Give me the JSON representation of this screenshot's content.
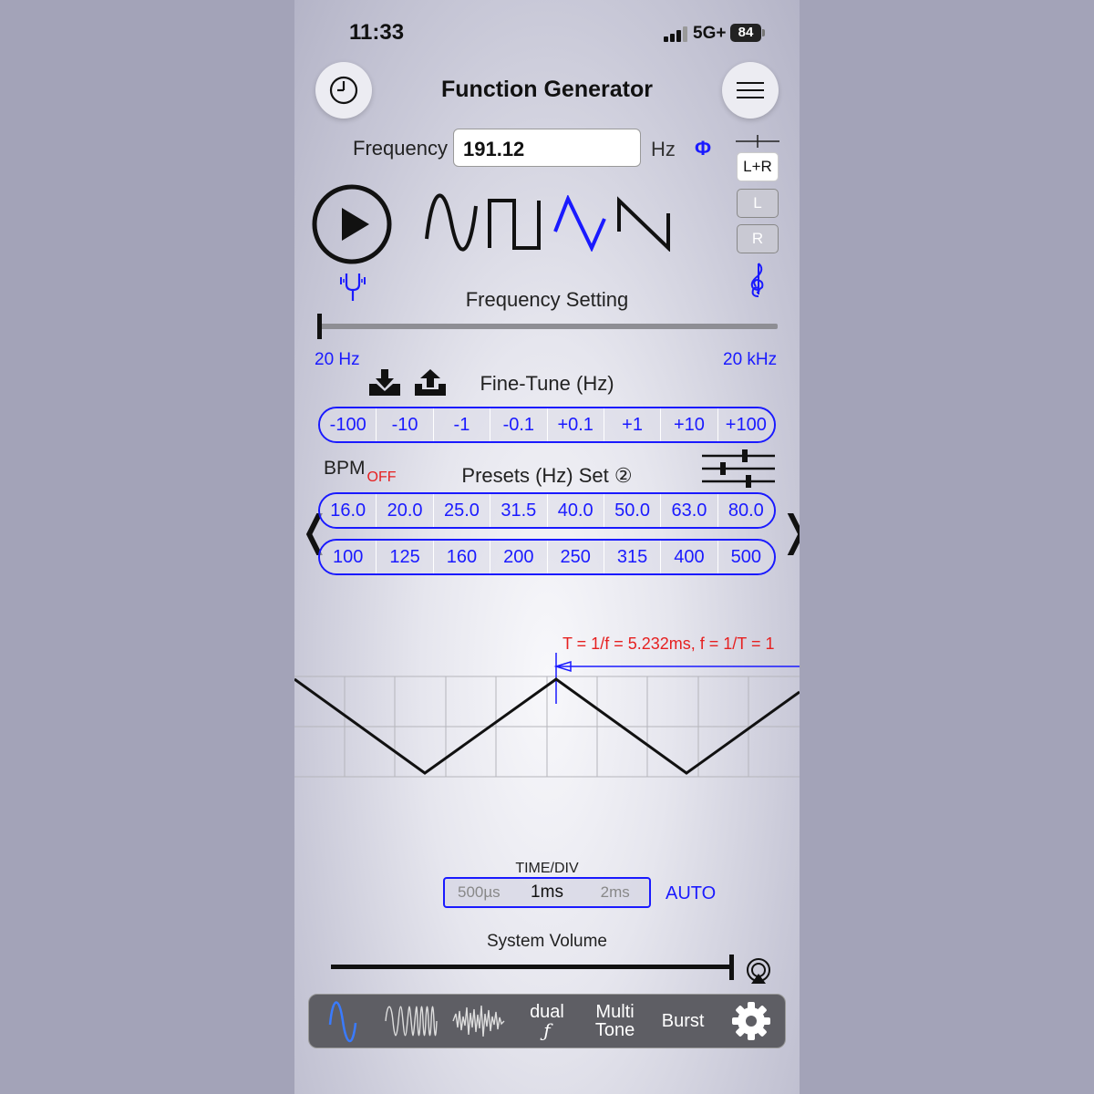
{
  "status_bar": {
    "time": "11:33",
    "network": "5G+",
    "battery": "84"
  },
  "header": {
    "title": "Function Generator"
  },
  "frequency": {
    "label": "Frequency",
    "value": "191.12",
    "unit": "Hz",
    "phase_symbol": "Φ"
  },
  "channels": {
    "both": "L+R",
    "left": "L",
    "right": "R",
    "selected": "L+R"
  },
  "waveforms": {
    "selected": "triangle",
    "options": [
      "sine",
      "square",
      "triangle",
      "sawtooth"
    ]
  },
  "frequency_setting": {
    "label": "Frequency Setting",
    "min_label": "20 Hz",
    "max_label": "20 kHz",
    "slider_fraction": 0.0
  },
  "fine_tune": {
    "label": "Fine-Tune (Hz)",
    "steps": [
      "-100",
      "-10",
      "-1",
      "-0.1",
      "+0.1",
      "+1",
      "+10",
      "+100"
    ]
  },
  "presets": {
    "bpm_label": "BPM",
    "bpm_state": "OFF",
    "label": "Presets (Hz) Set ②",
    "row1": [
      "16.0",
      "20.0",
      "25.0",
      "31.5",
      "40.0",
      "50.0",
      "63.0",
      "80.0"
    ],
    "row2": [
      "100",
      "125",
      "160",
      "200",
      "250",
      "315",
      "400",
      "500"
    ],
    "prev_arrow": "❬",
    "next_arrow": "❭"
  },
  "scope": {
    "period_text": "T = 1/f = 5.232ms, f = 1/T = 1"
  },
  "time_div": {
    "label": "TIME/DIV",
    "options": [
      "500µs",
      "1ms",
      "2ms"
    ],
    "selected": "1ms",
    "auto_label": "AUTO"
  },
  "volume": {
    "label": "System Volume",
    "level": 1.0
  },
  "tabbar": {
    "dual_label_1": "dual",
    "dual_label_2": "ƒ",
    "multi_label_1": "Multi",
    "multi_label_2": "Tone",
    "burst_label": "Burst"
  },
  "colors": {
    "accent": "#1a1aff",
    "warning": "#e62020",
    "tabbar": "#5e5e64"
  }
}
